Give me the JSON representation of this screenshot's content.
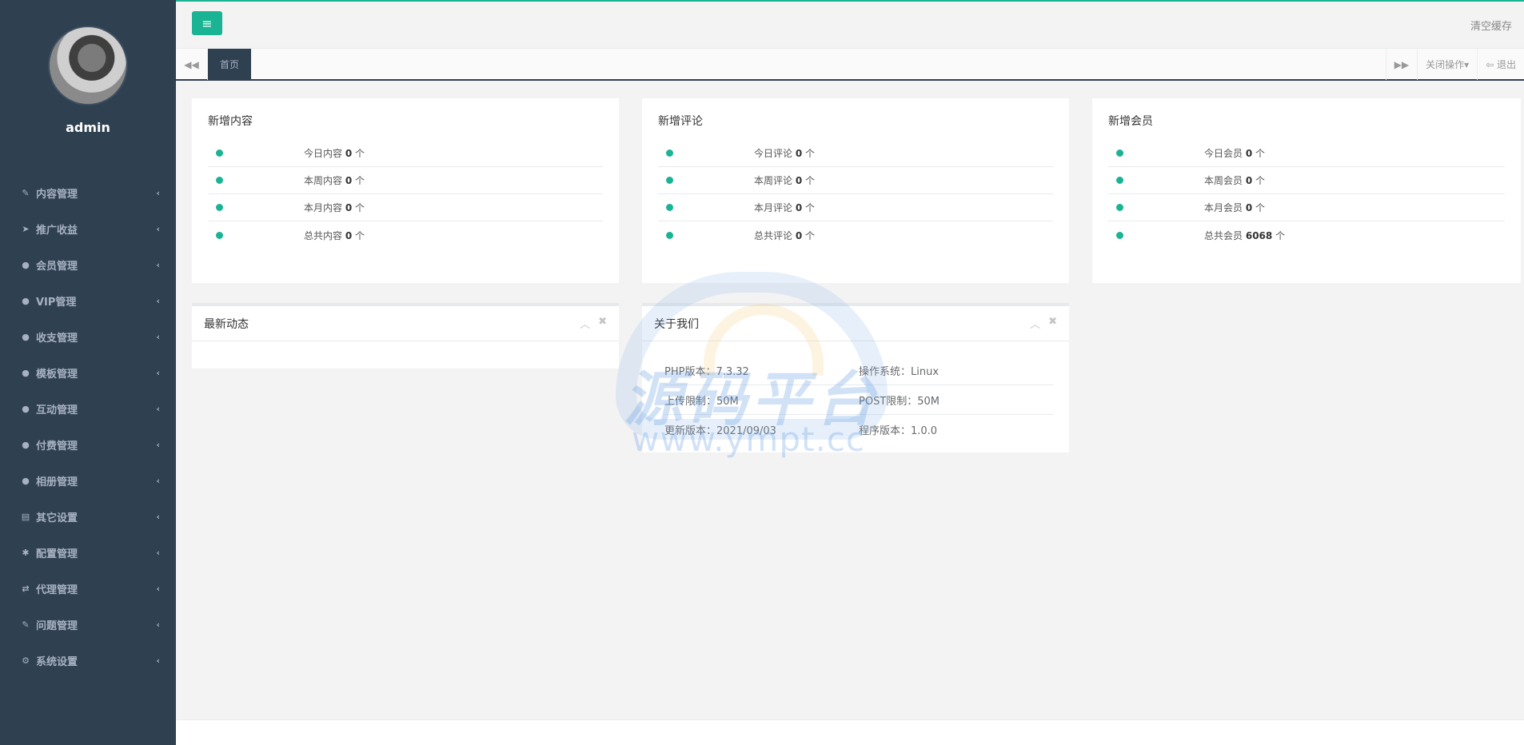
{
  "sidebar": {
    "username": "admin",
    "items": [
      {
        "label": "内容管理",
        "icon": "edit-icon",
        "glyph": "✎"
      },
      {
        "label": "推广收益",
        "icon": "paper-plane-icon",
        "glyph": "➤"
      },
      {
        "label": "会员管理",
        "icon": "user-icon",
        "glyph": "●"
      },
      {
        "label": "VIP管理",
        "icon": "user-icon",
        "glyph": "●"
      },
      {
        "label": "收支管理",
        "icon": "user-icon",
        "glyph": "●"
      },
      {
        "label": "模板管理",
        "icon": "user-icon",
        "glyph": "●"
      },
      {
        "label": "互动管理",
        "icon": "user-icon",
        "glyph": "●"
      },
      {
        "label": "付费管理",
        "icon": "user-icon",
        "glyph": "●"
      },
      {
        "label": "相册管理",
        "icon": "user-icon",
        "glyph": "●"
      },
      {
        "label": "其它设置",
        "icon": "book-icon",
        "glyph": "▤"
      },
      {
        "label": "配置管理",
        "icon": "asterisk-icon",
        "glyph": "✱"
      },
      {
        "label": "代理管理",
        "icon": "exchange-icon",
        "glyph": "⇄"
      },
      {
        "label": "问题管理",
        "icon": "edit-icon",
        "glyph": "✎"
      },
      {
        "label": "系统设置",
        "icon": "cogs-icon",
        "glyph": "⚙"
      }
    ]
  },
  "topbar": {
    "menu_glyph": "≡",
    "clear_cache": "清空缓存"
  },
  "tabs": {
    "prev_glyph": "◀◀",
    "home": "首页",
    "next_glyph": "▶▶",
    "close_ops": "关闭操作▾",
    "logout": "⇦ 退出"
  },
  "stats": [
    {
      "title": "新增内容",
      "rows": [
        {
          "label": "今日内容",
          "value": "0",
          "unit": "个"
        },
        {
          "label": "本周内容",
          "value": "0",
          "unit": "个"
        },
        {
          "label": "本月内容",
          "value": "0",
          "unit": "个"
        },
        {
          "label": "总共内容",
          "value": "0",
          "unit": "个"
        }
      ]
    },
    {
      "title": "新增评论",
      "rows": [
        {
          "label": "今日评论",
          "value": "0",
          "unit": "个"
        },
        {
          "label": "本周评论",
          "value": "0",
          "unit": "个"
        },
        {
          "label": "本月评论",
          "value": "0",
          "unit": "个"
        },
        {
          "label": "总共评论",
          "value": "0",
          "unit": "个"
        }
      ]
    },
    {
      "title": "新增会员",
      "rows": [
        {
          "label": "今日会员",
          "value": "0",
          "unit": "个"
        },
        {
          "label": "本周会员",
          "value": "0",
          "unit": "个"
        },
        {
          "label": "本月会员",
          "value": "0",
          "unit": "个"
        },
        {
          "label": "总共会员",
          "value": "6068",
          "unit": "个"
        }
      ]
    }
  ],
  "activity": {
    "title": "最新动态"
  },
  "about": {
    "title": "关于我们",
    "rows": [
      [
        "PHP版本：7.3.32",
        "操作系统：Linux"
      ],
      [
        "上传限制：50M",
        "POST限制：50M"
      ],
      [
        "更新版本：2021/09/03",
        "程序版本：1.0.0"
      ]
    ]
  },
  "panel_tools": {
    "collapse_glyph": "︿",
    "close_glyph": "✖"
  },
  "watermark": {
    "text": "源码平台",
    "url": "www.ympt.cc"
  }
}
